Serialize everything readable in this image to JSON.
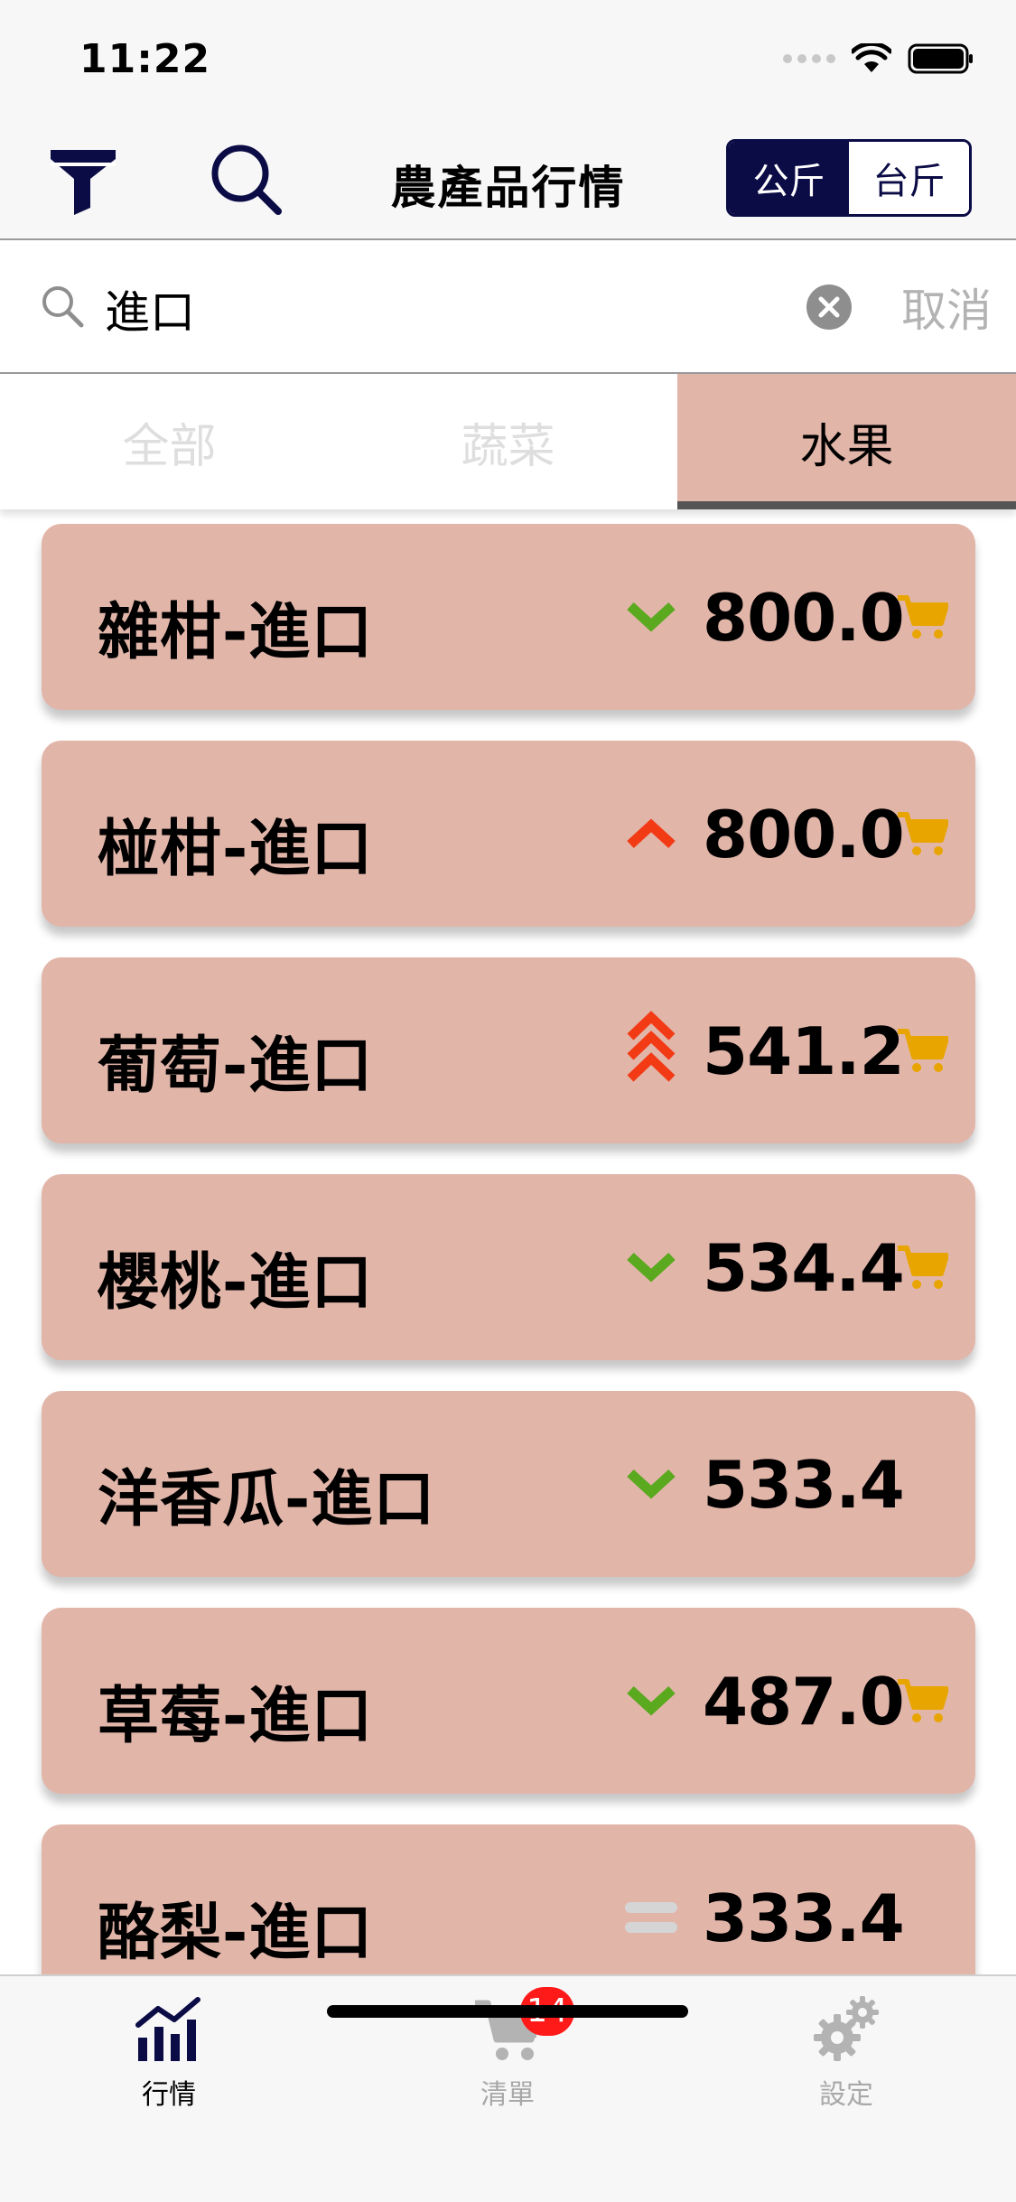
{
  "status_bar": {
    "time": "11:22"
  },
  "nav": {
    "title": "農產品行情",
    "unit_options": [
      "公斤",
      "台斤"
    ],
    "selected_unit": "公斤"
  },
  "search": {
    "value": "進口",
    "cancel_label": "取消"
  },
  "tabs": [
    {
      "label": "全部",
      "selected": false
    },
    {
      "label": "蔬菜",
      "selected": false
    },
    {
      "label": "水果",
      "selected": true
    }
  ],
  "items": [
    {
      "name": "雜柑-進口",
      "trend": "down",
      "price": "800.0",
      "cart": true
    },
    {
      "name": "椪柑-進口",
      "trend": "up",
      "price": "800.0",
      "cart": true
    },
    {
      "name": "葡萄-進口",
      "trend": "double-up",
      "price": "541.2",
      "cart": true
    },
    {
      "name": "櫻桃-進口",
      "trend": "down",
      "price": "534.4",
      "cart": true
    },
    {
      "name": "洋香瓜-進口",
      "trend": "down",
      "price": "533.4",
      "cart": false
    },
    {
      "name": "草莓-進口",
      "trend": "down",
      "price": "487.0",
      "cart": true
    },
    {
      "name": "酪梨-進口",
      "trend": "flat",
      "price": "333.4",
      "cart": false
    }
  ],
  "tab_bar": {
    "items": [
      {
        "label": "行情",
        "icon": "chart-icon",
        "active": true
      },
      {
        "label": "清單",
        "icon": "cart-icon",
        "active": false,
        "badge": "14"
      },
      {
        "label": "設定",
        "icon": "gear-icon",
        "active": false
      }
    ]
  },
  "colors": {
    "accent_navy": "#0b0b46",
    "card_bg": "#e2b5a9",
    "trend_down": "#5aa91f",
    "trend_up": "#f23a14",
    "trend_flat": "#d5d5d5",
    "cart": "#e8a500",
    "badge": "#ff1a1a"
  }
}
